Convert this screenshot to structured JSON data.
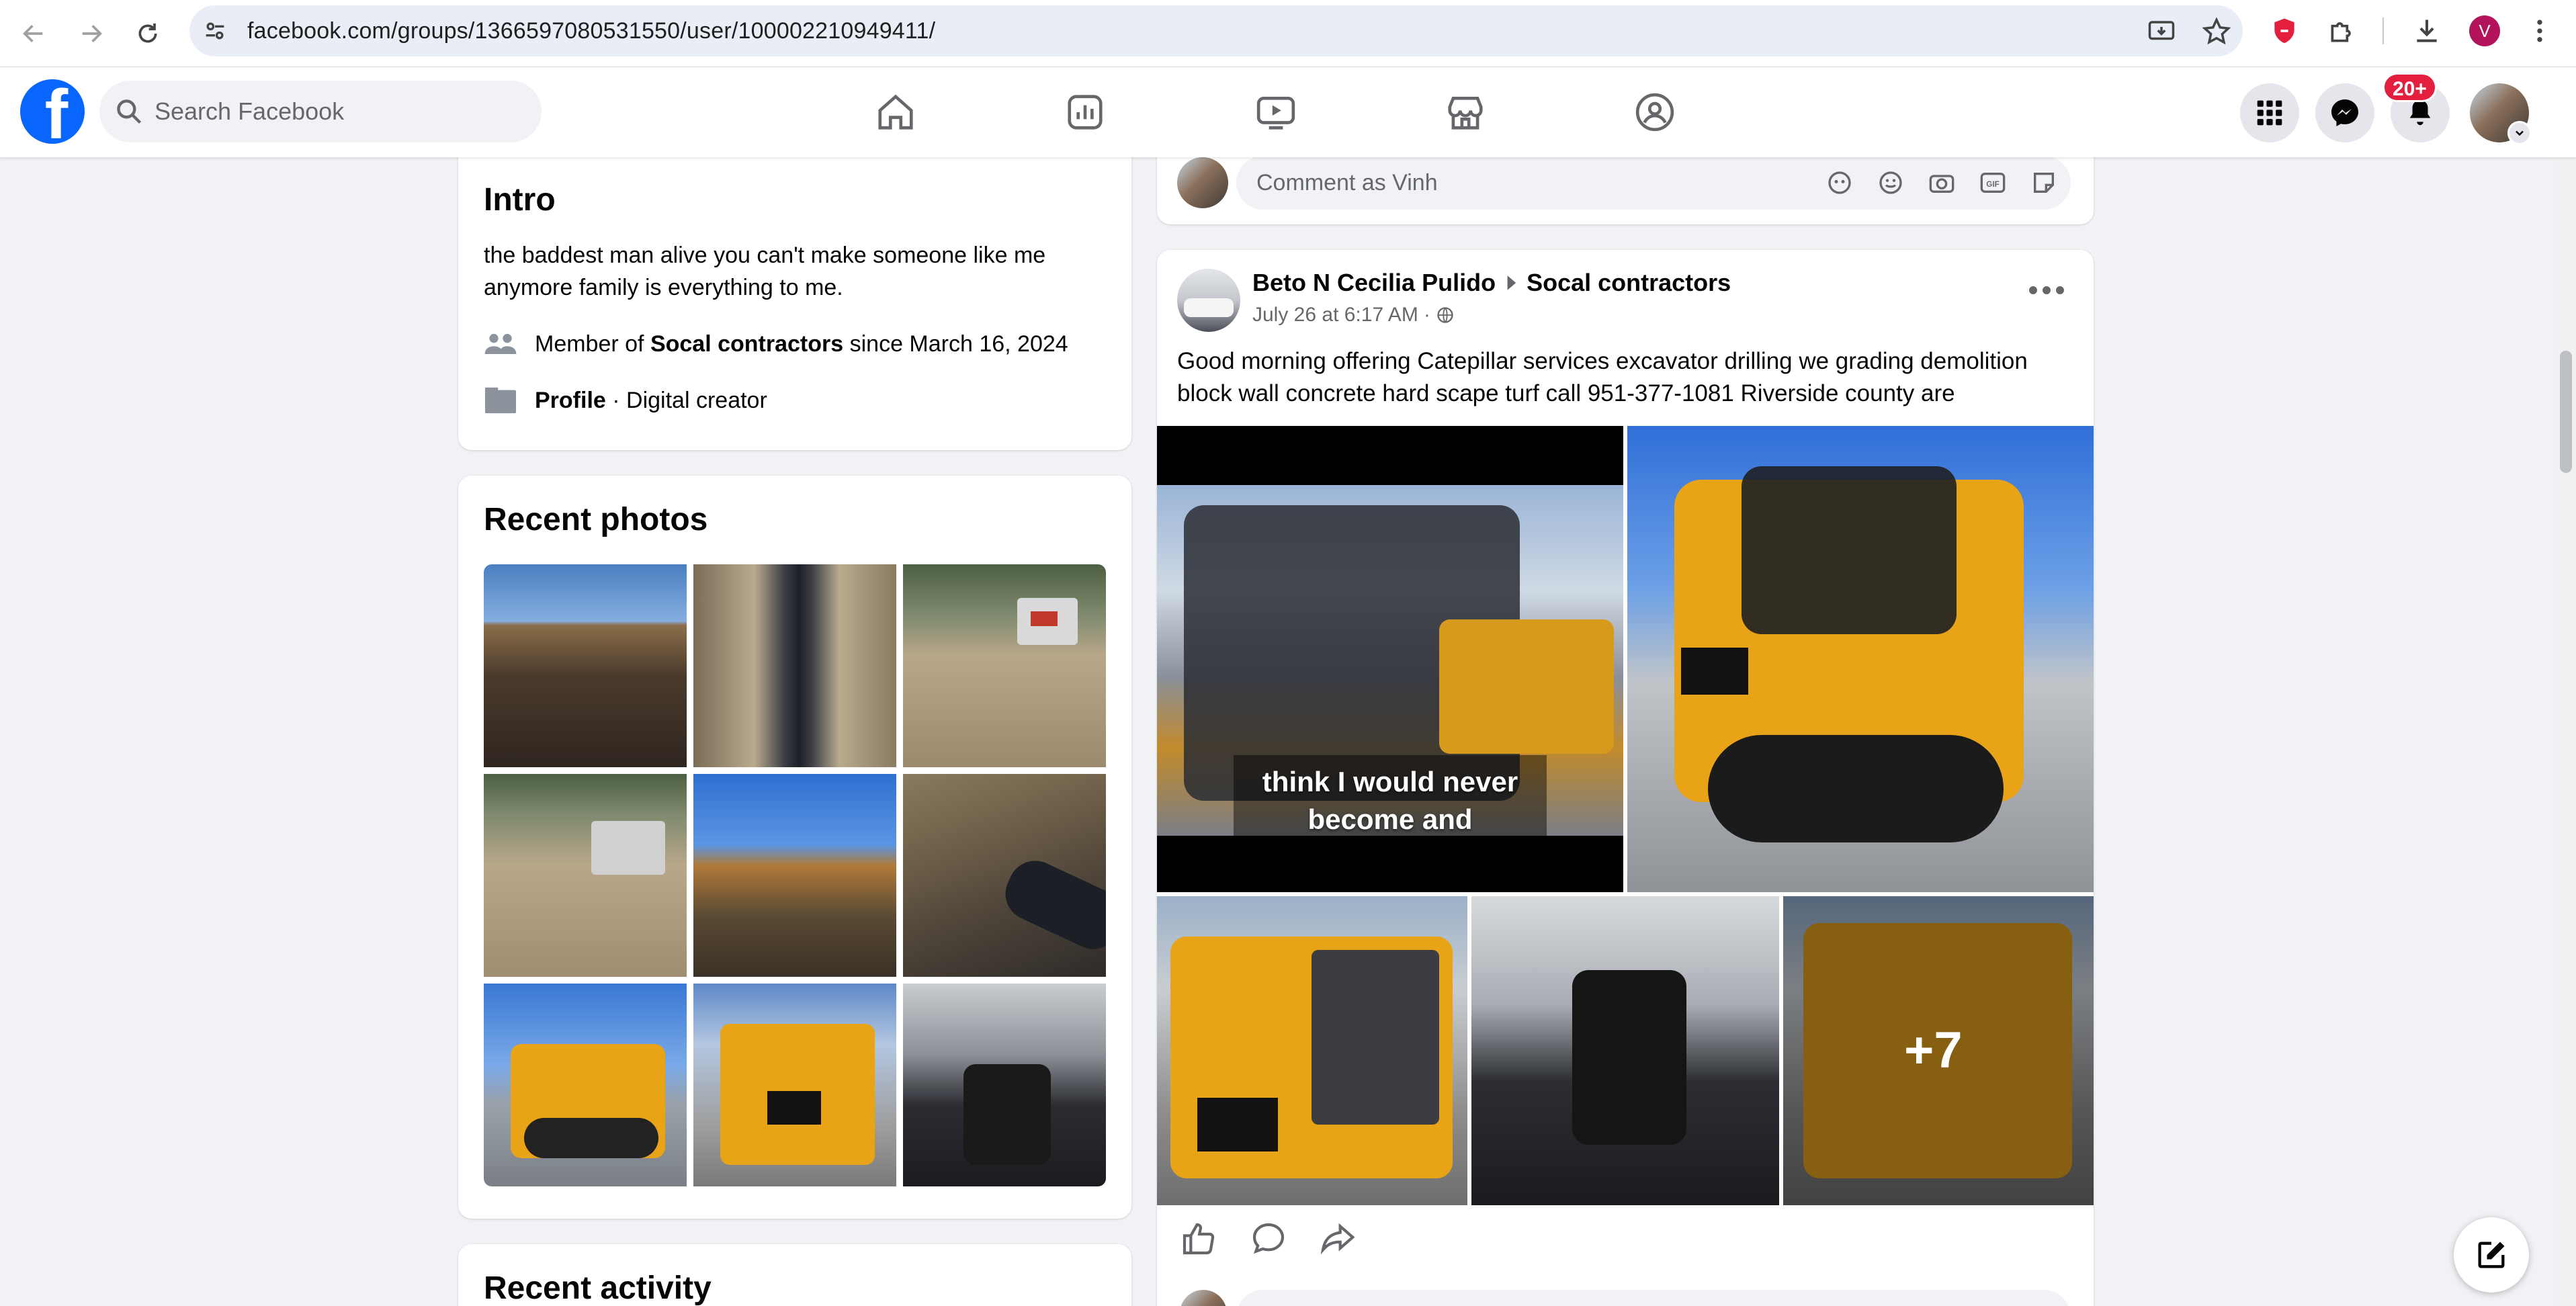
{
  "browser": {
    "url": "facebook.com/groups/1366597080531550/user/100002210949411/",
    "profile_initial": "V"
  },
  "topbar": {
    "search_placeholder": "Search Facebook",
    "notifications_badge": "20+"
  },
  "intro": {
    "title": "Intro",
    "bio": "the baddest man alive you can't make someone like me anymore family is everything to me.",
    "member_prefix": "Member of ",
    "member_group": "Socal contractors",
    "member_suffix": " since March 16, 2024",
    "profile_label": "Profile",
    "profile_sep": " · ",
    "profile_type": "Digital creator"
  },
  "recent_photos": {
    "title": "Recent photos"
  },
  "recent_activity": {
    "title": "Recent activity"
  },
  "comment_box": {
    "placeholder": "Comment as Vinh"
  },
  "post": {
    "author": "Beto N Cecilia Pulido",
    "group": "Socal contractors",
    "time": "July 26 at 6:17 AM",
    "dot": "·",
    "text": "Good morning offering Catepillar services excavator drilling we grading demolition block wall concrete hard scape turf call 951-377-1081 Riverside county are",
    "video_caption_line1": "think I would never",
    "video_caption_line2": "become and",
    "more_count": "+7"
  },
  "colors": {
    "fb_blue": "#0866ff",
    "badge_red": "#e41e3f",
    "cat_yellow": "#e8a317"
  }
}
